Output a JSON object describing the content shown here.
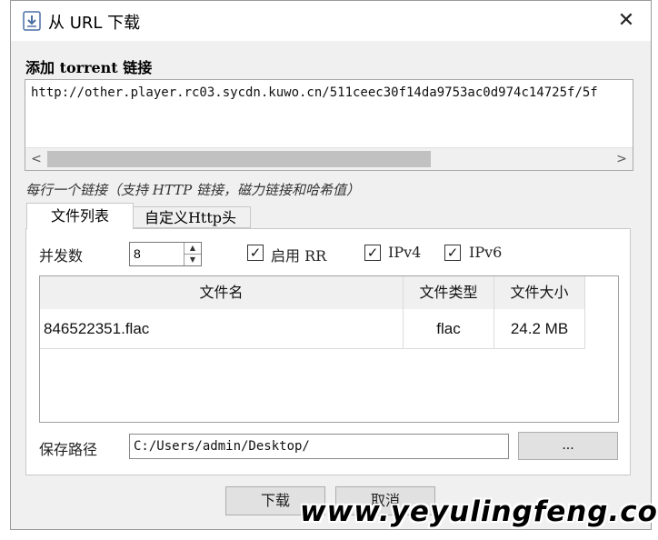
{
  "window": {
    "title": "从 URL 下载",
    "close_symbol": "✕"
  },
  "torrent": {
    "label": "添加 torrent 链接",
    "url": "http://other.player.rc03.sycdn.kuwo.cn/511ceec30f14da9753ac0d974c14725f/5f",
    "hint": "每行一个链接（支持 HTTP 链接，磁力链接和哈希值）"
  },
  "tabs": [
    {
      "label": "文件列表"
    },
    {
      "label": "自定义Http头"
    }
  ],
  "options": {
    "concurrency_label": "并发数",
    "concurrency_value": "8",
    "rr_label": "启用 RR",
    "ipv4_label": "IPv4",
    "ipv6_label": "IPv6",
    "check_mark": "✓"
  },
  "table": {
    "headers": [
      "文件名",
      "文件类型",
      "文件大小"
    ],
    "rows": [
      {
        "name": "846522351.flac",
        "type": "flac",
        "size": "24.2 MB"
      }
    ]
  },
  "save": {
    "label": "保存路径",
    "path": "C:/Users/admin/Desktop/",
    "browse_label": "..."
  },
  "buttons": {
    "download": "下载",
    "cancel": "取消"
  },
  "scroll": {
    "left": "<",
    "right": ">"
  },
  "spin": {
    "up": "▲",
    "down": "▼"
  },
  "watermark": "www.yeyulingfeng.com"
}
